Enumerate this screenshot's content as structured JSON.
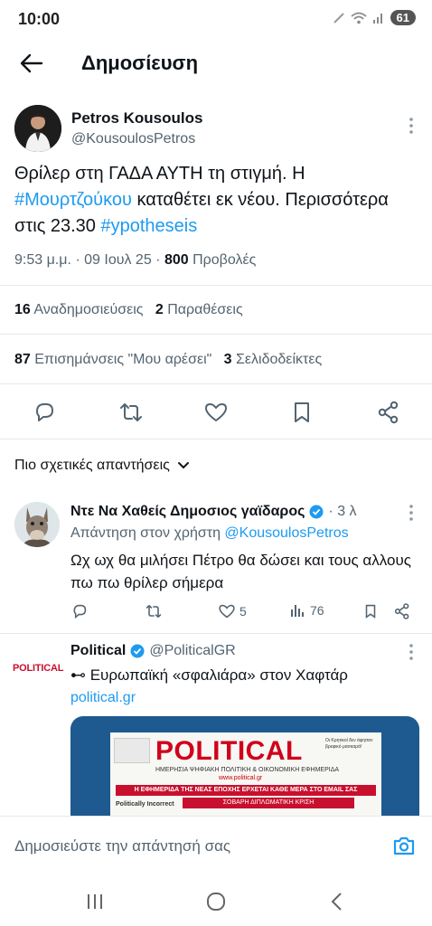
{
  "status_bar": {
    "time": "10:00",
    "battery": "61"
  },
  "header": {
    "title": "Δημοσίευση"
  },
  "tweet": {
    "author_name": "Petros Kousoulos",
    "author_handle": "@KousoulosPetros",
    "text_part1": "Θρίλερ στη ΓΑΔΑ ΑΥΤΗ τη στιγμή. Η ",
    "hashtag1": "#Μουρτζούκου",
    "text_part2": " καταθέτει εκ νέου. Περισσότερα στις 23.30 ",
    "hashtag2": "#ypotheseis",
    "timestamp": "9:53 μ.μ. · 09 Ιουλ 25 · ",
    "views_count": "800",
    "views_label": " Προβολές",
    "reposts_count": "16",
    "reposts_label": "Αναδημοσιεύσεις",
    "quotes_count": "2",
    "quotes_label": "Παραθέσεις",
    "likes_count": "87",
    "likes_label": "Επισημάνσεις \"Μου αρέσει\"",
    "bookmarks_count": "3",
    "bookmarks_label": "Σελιδοδείκτες"
  },
  "sort": {
    "label": "Πιο σχετικές απαντήσεις"
  },
  "replies": [
    {
      "name": "Ντε Να Χαθείς Δημοσιος γαϊδαρος",
      "time": "· 3 λ",
      "reply_to_prefix": "Απάντηση στον χρήστη ",
      "reply_to_handle": "@KousoulosPetros",
      "text": "Ωχ ωχ θα μιλήσει Πέτρο θα δώσει και τους αλλους πω πω θρίλερ σήμερα",
      "likes": "5",
      "views": "76"
    },
    {
      "logo_text": "POLITICAL",
      "name": "Political",
      "handle": "@PoliticalGR",
      "text": "⊷ Ευρωπαϊκή «σφαλιάρα» στον Χαφτάρ",
      "link": "political.gr",
      "image": {
        "headline": "POLITICAL",
        "subtitle": "ΗΜΕΡΗΣΙΑ ΨΗΦΙΑΚΗ ΠΟΛΙΤΙΚΗ & ΟΙΚΟΝΟΜΙΚΗ ΕΦΗΜΕΡΙΔΑ",
        "url": "www.political.gr",
        "banner": "Η ΕΦΗΜΕΡΙΔΑ ΤΗΣ ΝΕΑΣ ΕΠΟΧΗΣ ΕΡΧΕΤΑΙ ΚΑΘΕ ΜΕΡΑ ΣΤΟ EMAIL ΣΑΣ",
        "redbox": "ΣΟΒΑΡΗ ΔΙΠΛΩΜΑΤΙΚΗ ΚΡΙΣΗ",
        "badge": "Politically Incorrect",
        "side": "Οι Κρητικοί δεν άφησαν βρεφικό μασκαρά!"
      }
    }
  ],
  "composer": {
    "placeholder": "Δημοσιεύστε την απάντησή σας"
  },
  "colors": {
    "accent": "#1d9bf0",
    "text": "#0f1419",
    "muted": "#536471",
    "brand_red": "#c8102e"
  }
}
